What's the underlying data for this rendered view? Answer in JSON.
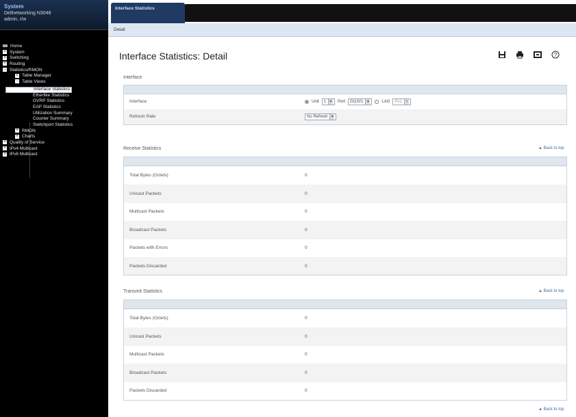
{
  "system": {
    "title": "System",
    "line1": "Dellnetworking N3048",
    "line2": "admin, r/w"
  },
  "nav": {
    "items": [
      {
        "label": "Home",
        "level": 0,
        "icon": "home-icon"
      },
      {
        "label": "System",
        "level": 0,
        "icon": "plus"
      },
      {
        "label": "Switching",
        "level": 0,
        "icon": "plus"
      },
      {
        "label": "Routing",
        "level": 0,
        "icon": "plus"
      },
      {
        "label": "Statistics/RMON",
        "level": 0,
        "icon": "minus"
      },
      {
        "label": "Table Manager",
        "level": 1,
        "icon": "plus"
      },
      {
        "label": "Table Views",
        "level": 1,
        "icon": "minus"
      },
      {
        "label": "Interface Statistics",
        "level": 3,
        "icon": "none",
        "selected": true
      },
      {
        "label": "Etherlike Statistics",
        "level": 3,
        "icon": "none"
      },
      {
        "label": "GVRP Statistics",
        "level": 3,
        "icon": "none"
      },
      {
        "label": "EAP Statistics",
        "level": 3,
        "icon": "none"
      },
      {
        "label": "Utilization Summary",
        "level": 3,
        "icon": "none"
      },
      {
        "label": "Counter Summary",
        "level": 3,
        "icon": "none"
      },
      {
        "label": "Switchport Statistics",
        "level": 3,
        "icon": "none"
      },
      {
        "label": "RMON",
        "level": 1,
        "icon": "plus"
      },
      {
        "label": "Charts",
        "level": 1,
        "icon": "plus"
      },
      {
        "label": "Quality of Service",
        "level": 0,
        "icon": "plus"
      },
      {
        "label": "IPv4 Multicast",
        "level": 0,
        "icon": "plus"
      },
      {
        "label": "IPv6 Multicast",
        "level": 0,
        "icon": "plus"
      }
    ]
  },
  "tabs": {
    "main": "Interface Statistics",
    "sub": "Detail"
  },
  "page": {
    "title": "Interface Statistics: Detail"
  },
  "toolbar": {
    "save_icon": "save-icon",
    "print_icon": "print-icon",
    "refresh_icon": "refresh-icon",
    "help_icon": "help-icon"
  },
  "interface_section": {
    "title": "Interface",
    "interface_label": "Interface",
    "unit_label": "Unit",
    "unit_value": "1",
    "port_label": "Port",
    "port_value": "Gi1/0/1",
    "lag_label": "LAG",
    "lag_value": "Po1",
    "refresh_label": "Refresh Rate",
    "refresh_value": "No Refresh"
  },
  "receive": {
    "title": "Receive Statistics",
    "back_to_top": "Back to top",
    "rows": [
      {
        "label": "Total Bytes (Octets)",
        "value": "0"
      },
      {
        "label": "Unicast Packets",
        "value": "0"
      },
      {
        "label": "Multicast Packets",
        "value": "0"
      },
      {
        "label": "Broadcast Packets",
        "value": "0"
      },
      {
        "label": "Packets with Errors",
        "value": "0"
      },
      {
        "label": "Packets Discarded",
        "value": "0"
      }
    ]
  },
  "transmit": {
    "title": "Transmit Statistics",
    "back_to_top": "Back to top",
    "rows": [
      {
        "label": "Total Bytes (Octets)",
        "value": "0"
      },
      {
        "label": "Unicast Packets",
        "value": "0"
      },
      {
        "label": "Multicast Packets",
        "value": "0"
      },
      {
        "label": "Broadcast Packets",
        "value": "0"
      },
      {
        "label": "Packets Discarded",
        "value": "0"
      }
    ]
  },
  "footer": {
    "back_to_top": "Back to top"
  }
}
